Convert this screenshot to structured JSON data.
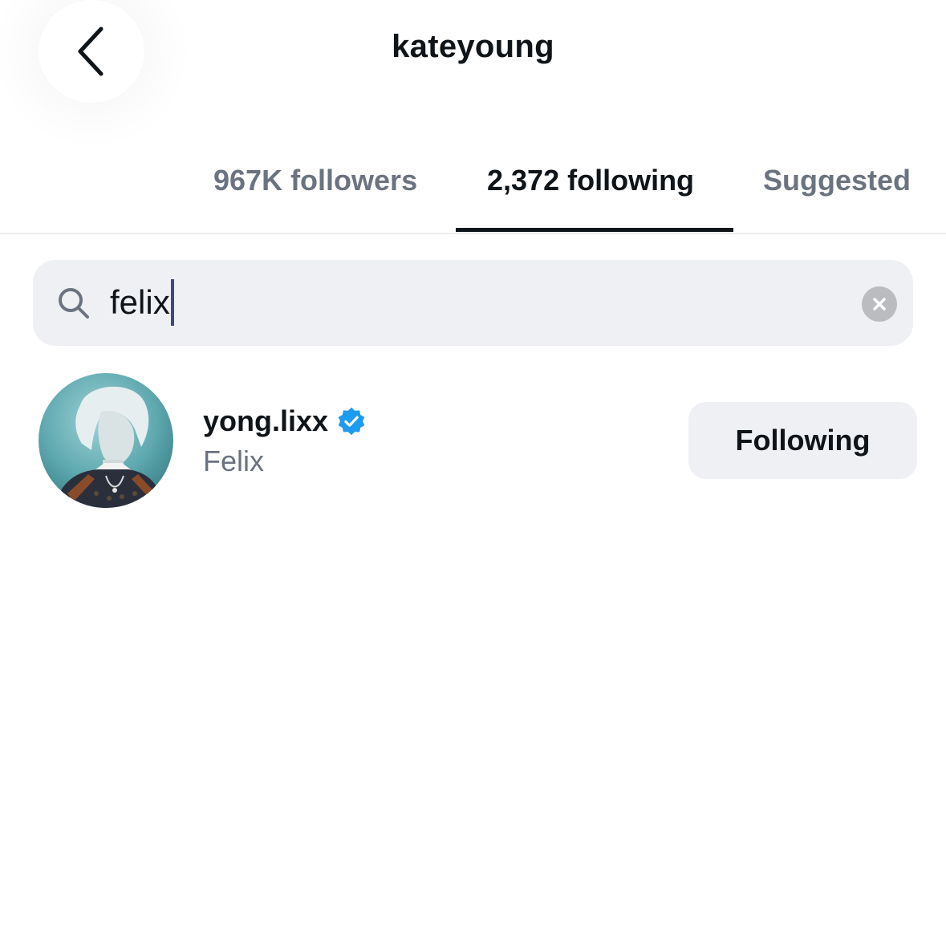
{
  "header": {
    "title": "kateyoung",
    "back_icon": "chevron-left-icon"
  },
  "tabs": [
    {
      "label": "967K followers",
      "active": false
    },
    {
      "label": "2,372 following",
      "active": true
    },
    {
      "label": "Suggested",
      "active": false
    }
  ],
  "search": {
    "value": "felix",
    "search_icon": "search-icon",
    "clear_icon": "clear-icon"
  },
  "results": [
    {
      "username": "yong.lixx",
      "verified": true,
      "full_name": "Felix",
      "action_label": "Following"
    }
  ],
  "colors": {
    "text_primary": "#0f1419",
    "text_secondary": "#6b7380",
    "input_background": "#eff0f3",
    "verified_badge": "#1d9bf0",
    "tab_indicator": "#0f1419"
  }
}
